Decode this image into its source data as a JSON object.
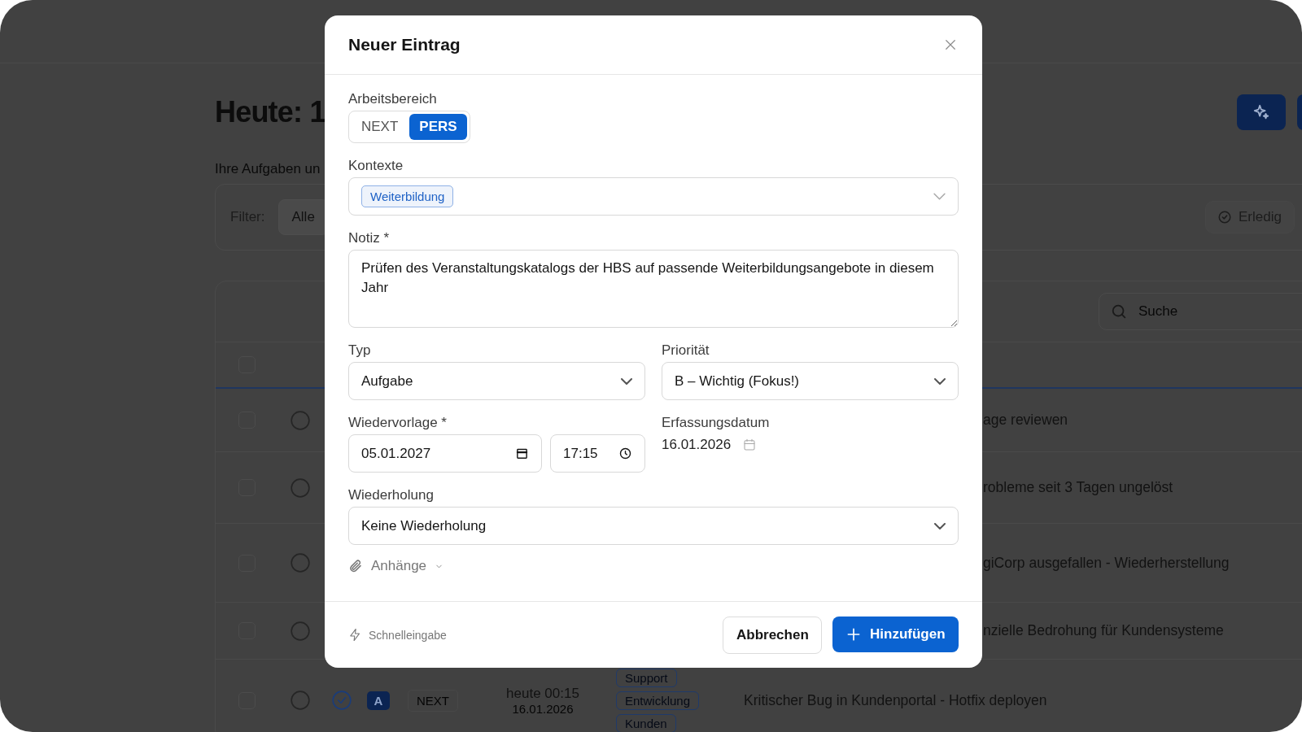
{
  "app": {
    "title": "Heute: 1",
    "subtitle": "Ihre Aufgaben un",
    "filter": {
      "label": "Filter:",
      "value": "Alle"
    },
    "done_filter": "Erledig",
    "search": {
      "placeholder": "Suche"
    },
    "select_all": {
      "selected": false
    },
    "rows": [
      {
        "selected": false,
        "title": "age reviewen"
      },
      {
        "selected": false,
        "title": "robleme seit 3 Tagen ungelöst"
      },
      {
        "selected": false,
        "title": "giCorp ausgefallen - Wiederherstellung"
      },
      {
        "selected": false,
        "title": "nzielle Bedrohung für Kundensysteme"
      },
      {
        "selected": false,
        "priority": "A",
        "workspace": "NEXT",
        "time": "heute 00:15",
        "date": "16.01.2026",
        "tags": [
          "Support",
          "Entwicklung",
          "Kunden"
        ],
        "title": "Kritischer Bug in Kundenportal - Hotfix deployen"
      }
    ]
  },
  "dialog": {
    "title": "Neuer Eintrag",
    "workspace": {
      "label": "Arbeitsbereich",
      "options": [
        {
          "label": "NEXT",
          "selected": false
        },
        {
          "label": "PERS",
          "selected": true
        }
      ]
    },
    "contexts": {
      "label": "Kontexte",
      "tags": [
        "Weiterbildung"
      ]
    },
    "note": {
      "label": "Notiz *",
      "value": "Prüfen des Veranstaltungskatalogs der HBS auf passende Weiterbildungsangebote in diesem Jahr"
    },
    "type": {
      "label": "Typ",
      "value": "Aufgabe"
    },
    "priority": {
      "label": "Priorität",
      "value": "B – Wichtig (Fokus!)"
    },
    "follow_up": {
      "label": "Wiedervorlage *",
      "date": "05.01.2027",
      "time": "17:15"
    },
    "created": {
      "label": "Erfassungsdatum",
      "value": "16.01.2026"
    },
    "recurrence": {
      "label": "Wiederholung",
      "value": "Keine Wiederholung"
    },
    "attachments": {
      "label": "Anhänge",
      "expanded": false
    },
    "quick_entry": "Schnelleingabe",
    "buttons": {
      "cancel": "Abbrechen",
      "submit": "Hinzufügen"
    }
  }
}
